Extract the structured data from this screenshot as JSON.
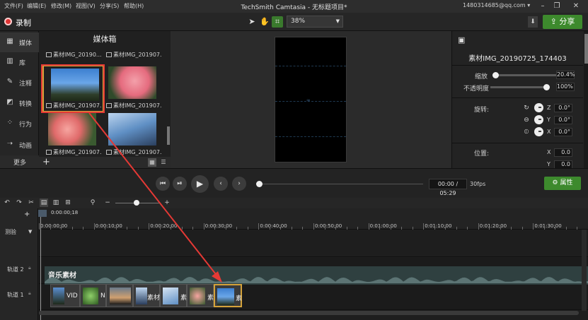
{
  "menubar": {
    "items": [
      "文件(F)",
      "编辑(E)",
      "修改(M)",
      "视图(V)",
      "分享(S)",
      "帮助(H)"
    ],
    "title": "TechSmith Camtasia - 无标题项目*",
    "account": "1480314685@qq.com ▾"
  },
  "toolbar": {
    "record_label": "录制",
    "zoom": "38%",
    "share_label": "分享"
  },
  "nav": {
    "items": [
      "媒体",
      "库",
      "注释",
      "转换",
      "行为",
      "动画"
    ],
    "more": "更多"
  },
  "media_bin": {
    "title": "媒体箱",
    "items": [
      {
        "caption": "素材IMG_20190..."
      },
      {
        "caption": "素材IMG_201907..."
      },
      {
        "caption": "素材IMG_201907..."
      },
      {
        "caption": "素材IMG_201907..."
      },
      {
        "caption": "素材IMG_201907..."
      },
      {
        "caption": "素材IMG_201907..."
      }
    ]
  },
  "properties": {
    "title": "素材IMG_20190725_174403",
    "scale_label": "缩放",
    "scale_value": "20.4%",
    "opacity_label": "不透明度",
    "opacity_value": "100%",
    "rotation_label": "旋转:",
    "rot": [
      {
        "axis": "Z",
        "value": "0.0°"
      },
      {
        "axis": "Y",
        "value": "0.0°"
      },
      {
        "axis": "X",
        "value": "0.0°"
      }
    ],
    "position_label": "位置:",
    "pos": [
      {
        "axis": "X",
        "value": "0.0"
      },
      {
        "axis": "Y",
        "value": "0.0"
      }
    ]
  },
  "playback": {
    "time": "00:00 / 05:29",
    "fps": "30fps",
    "props_button": "属性"
  },
  "timeline": {
    "playhead_time": "0:00:00;18",
    "ticks": [
      "0:00:00;00",
      "0:00:10;00",
      "0:00:20;00",
      "0:00:30;00",
      "0:00:40;00",
      "0:00:50;00",
      "0:01:00;00",
      "0:01:10;00",
      "0:01:20;00",
      "0:01:30;00"
    ],
    "marker_label": "测验",
    "track2_label": "轨道 2",
    "track1_label": "轨道 1",
    "music_clip_label": "音乐素材",
    "clips": [
      {
        "text": "VID"
      },
      {
        "text": "N"
      },
      {
        "text": ""
      },
      {
        "text": "素材"
      },
      {
        "text": "素"
      },
      {
        "text": "素"
      },
      {
        "text": "素"
      }
    ]
  },
  "colors": {
    "accent_green": "#3d8a2d",
    "selection_gold": "#d4a23a",
    "record_red": "#e03434",
    "arrow_red": "#e53935"
  }
}
